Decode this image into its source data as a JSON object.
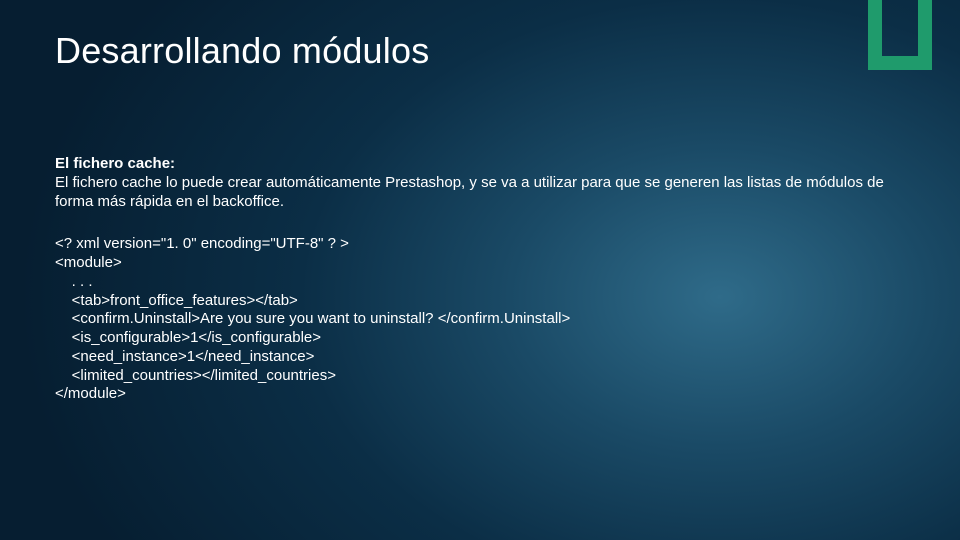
{
  "title": "Desarrollando módulos",
  "subtitle": "El fichero cache:",
  "description": "El fichero cache lo puede crear automáticamente Prestashop, y se va a utilizar para que se generen las listas de módulos de forma más rápida en el backoffice.",
  "code": "<? xml version=\"1. 0\" encoding=\"UTF-8\" ? >\n<module>\n    . . .\n    <tab>front_office_features></tab>\n    <confirm.Uninstall>Are you sure you want to uninstall? </confirm.Uninstall>\n    <is_configurable>1</is_configurable>\n    <need_instance>1</need_instance>\n    <limited_countries></limited_countries>\n</module>"
}
